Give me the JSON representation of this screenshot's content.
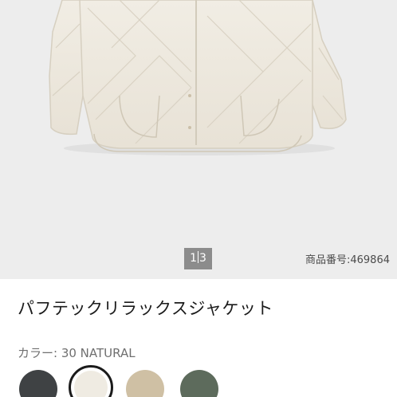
{
  "gallery": {
    "current_page": "1",
    "total_pages": "3",
    "product_number": "商品番号:469864"
  },
  "product": {
    "title": "パフテックリラックスジャケット",
    "color_label": "カラー: 30 NATURAL"
  },
  "swatches": [
    {
      "name": "dark-gray",
      "color": "#3f4244",
      "selected": false
    },
    {
      "name": "natural",
      "color": "#efebe2",
      "selected": true
    },
    {
      "name": "beige",
      "color": "#cfc0a4",
      "selected": false
    },
    {
      "name": "olive",
      "color": "#5d6b5c",
      "selected": false
    }
  ]
}
